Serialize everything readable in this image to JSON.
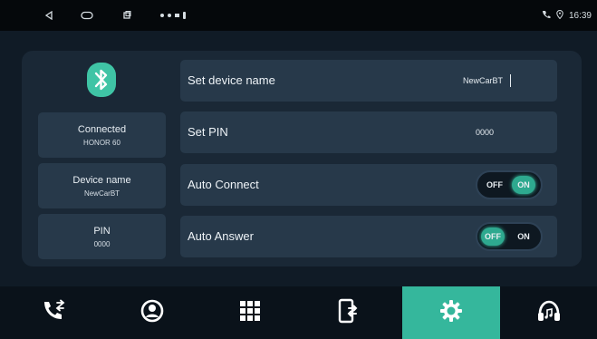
{
  "status_bar": {
    "icons": [
      "back-icon",
      "home-icon",
      "recents-icon",
      "notification-dots-icon"
    ],
    "right_icons": [
      "phone-icon",
      "gps-icon"
    ],
    "time": "16:39"
  },
  "bluetooth": {
    "icon": "bluetooth-icon",
    "color": "#3fc4a5"
  },
  "info": {
    "connected_label": "Connected",
    "connected_value": "HONOR 60",
    "device_name_label": "Device name",
    "device_name_value": "NewCarBT",
    "pin_label": "PIN",
    "pin_value": "0000"
  },
  "settings": {
    "set_device_name_label": "Set device name",
    "set_device_name_value": "NewCarBT",
    "set_pin_label": "Set PIN",
    "set_pin_value": "0000",
    "auto_connect_label": "Auto Connect",
    "auto_connect_off": "OFF",
    "auto_connect_on": "ON",
    "auto_connect_state": "ON",
    "auto_answer_label": "Auto Answer",
    "auto_answer_off": "OFF",
    "auto_answer_on": "ON",
    "auto_answer_state": "OFF"
  },
  "bottom_nav": {
    "items": [
      "dial-icon",
      "contacts-icon",
      "keypad-icon",
      "phone-transfer-icon",
      "settings-icon",
      "music-icon"
    ],
    "active": "settings-icon",
    "accent": "#35b79c"
  }
}
